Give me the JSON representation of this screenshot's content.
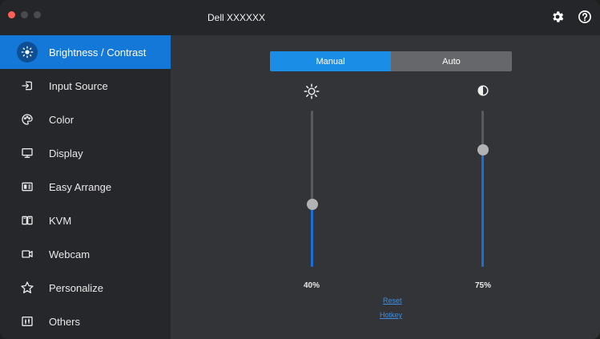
{
  "window": {
    "title": "Dell XXXXXX"
  },
  "sidebar": {
    "items": [
      {
        "label": "Brightness / Contrast",
        "icon": "brightness-icon"
      },
      {
        "label": "Input Source",
        "icon": "input-source-icon"
      },
      {
        "label": "Color",
        "icon": "color-palette-icon"
      },
      {
        "label": "Display",
        "icon": "monitor-icon"
      },
      {
        "label": "Easy Arrange",
        "icon": "layout-icon"
      },
      {
        "label": "KVM",
        "icon": "kvm-icon"
      },
      {
        "label": "Webcam",
        "icon": "webcam-icon"
      },
      {
        "label": "Personalize",
        "icon": "star-icon"
      },
      {
        "label": "Others",
        "icon": "sliders-icon"
      }
    ]
  },
  "main": {
    "mode": {
      "manual": "Manual",
      "auto": "Auto",
      "selected": "Manual"
    },
    "brightness": {
      "value": 40,
      "label": "40%"
    },
    "contrast": {
      "value": 75,
      "label": "75%"
    },
    "reset_label": "Reset",
    "hotkey_label": "Hotkey"
  },
  "colors": {
    "accent": "#1378d7",
    "slider_fill": "#1c6ed6",
    "link": "#3a8fe8"
  }
}
